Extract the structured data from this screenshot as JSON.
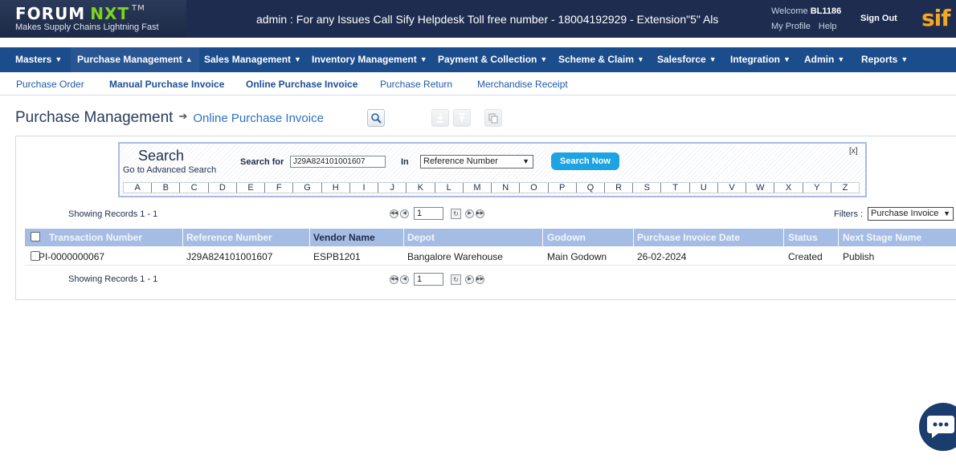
{
  "header": {
    "logo_main": "FORUM",
    "logo_accent": "NXT",
    "logo_tm": "TM",
    "logo_tagline": "Makes Supply Chains Lightning Fast",
    "announcement": "admin : For any Issues Call Sify Helpdesk Toll free number - 18004192929 - Extension\"5\" Als",
    "welcome_prefix": "Welcome",
    "user_id": "BL1186",
    "my_profile": "My Profile",
    "help": "Help",
    "sign_out": "Sign Out",
    "brand": "sif"
  },
  "main_nav": [
    {
      "label": "Masters"
    },
    {
      "label": "Purchase Management"
    },
    {
      "label": "Sales Management"
    },
    {
      "label": "Inventory Management"
    },
    {
      "label": "Payment & Collection"
    },
    {
      "label": "Scheme & Claim"
    },
    {
      "label": "Salesforce"
    },
    {
      "label": "Integration"
    },
    {
      "label": "Admin"
    },
    {
      "label": "Reports"
    }
  ],
  "sub_nav": [
    {
      "label": "Purchase Order"
    },
    {
      "label": "Manual Purchase Invoice"
    },
    {
      "label": "Online Purchase Invoice"
    },
    {
      "label": "Purchase Return"
    },
    {
      "label": "Merchandise Receipt"
    }
  ],
  "page": {
    "title": "Purchase Management",
    "arrow": "➔",
    "crumb": "Online Purchase Invoice"
  },
  "search": {
    "title": "Search",
    "advanced_link": "Go to Advanced Search",
    "search_for_label": "Search for",
    "search_value": "J29A824101001607",
    "in_label": "In",
    "in_selected": "Reference Number",
    "search_button": "Search Now",
    "close": "[x]",
    "letters": [
      "A",
      "B",
      "C",
      "D",
      "E",
      "F",
      "G",
      "H",
      "I",
      "J",
      "K",
      "L",
      "M",
      "N",
      "O",
      "P",
      "Q",
      "R",
      "S",
      "T",
      "U",
      "V",
      "W",
      "X",
      "Y",
      "Z"
    ]
  },
  "paging": {
    "showing_text": "Showing Records 1 - 1",
    "page_value": "1",
    "filters_label": "Filters :",
    "filter_selected": "Purchase Invoice"
  },
  "grid": {
    "headers": [
      "Transaction Number",
      "Reference Number",
      "Vendor Name",
      "Depot",
      "Godown",
      "Purchase Invoice Date",
      "Status",
      "Next Stage Name"
    ],
    "rows": [
      [
        "PI-0000000067",
        "J29A824101001607",
        "ESPB1201",
        "Bangalore Warehouse",
        "Main Godown",
        "26-02-2024",
        "Created",
        "Publish"
      ]
    ]
  },
  "colors": {
    "header_bg": "#1e2d4f",
    "nav_bg": "#1b4c8c",
    "accent_green": "#7ed321",
    "search_button": "#1ea3e2",
    "grid_header": "#a5bde4",
    "brand_orange": "#f5a623"
  },
  "icons": [
    "search-icon",
    "download-icon",
    "upload-icon",
    "copy-icon",
    "chat-icon"
  ]
}
